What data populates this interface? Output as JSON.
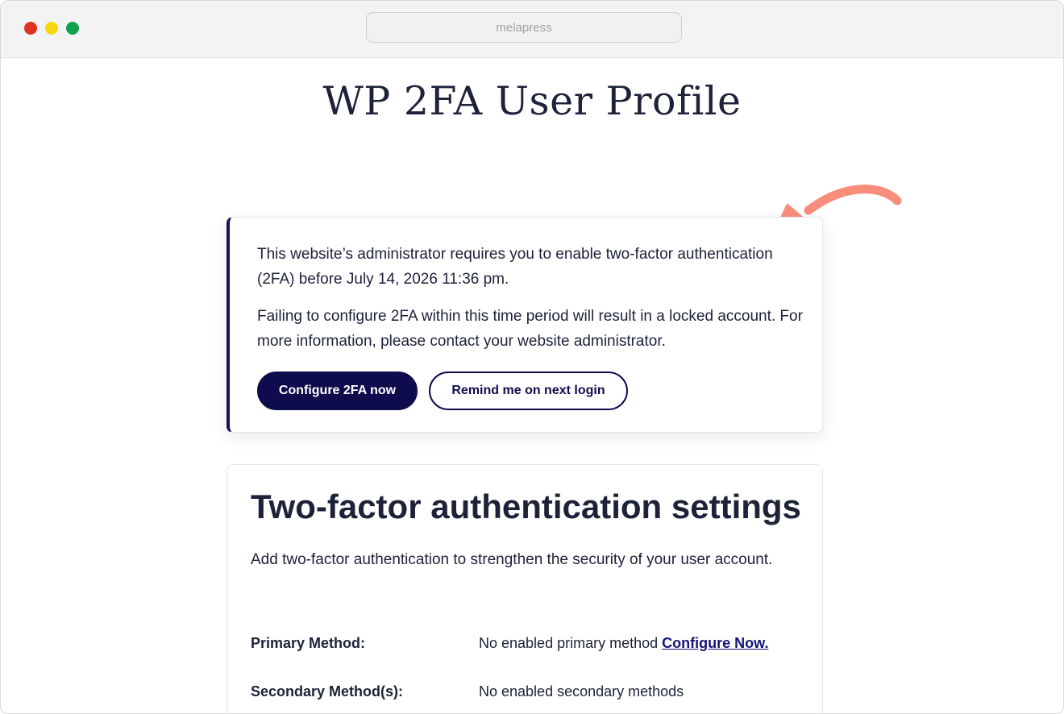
{
  "browser": {
    "address": "melapress"
  },
  "page": {
    "title": "WP 2FA User Profile"
  },
  "notice": {
    "line1": "This website’s administrator requires you to enable two-factor authentication (2FA) before July 14, 2026 11:36 pm.",
    "line2": "Failing to configure 2FA within this time period will result in a locked account. For more information, please contact your website administrator.",
    "configure_button": "Configure 2FA now",
    "remind_button": "Remind me on next login"
  },
  "settings": {
    "heading": "Two-factor authentication settings",
    "description": "Add two-factor authentication to strengthen the security of your user account.",
    "primary_label": "Primary Method:",
    "primary_value": "No enabled primary method",
    "primary_link": "Configure Now.",
    "secondary_label": "Secondary Method(s):",
    "secondary_value": "No enabled secondary methods"
  },
  "colors": {
    "brand_navy": "#0f0c4d",
    "text": "#1d2238",
    "arrow_accent": "#f98d7b",
    "link": "#14147a"
  },
  "icons": {
    "annotation": "curved-arrow-icon"
  }
}
